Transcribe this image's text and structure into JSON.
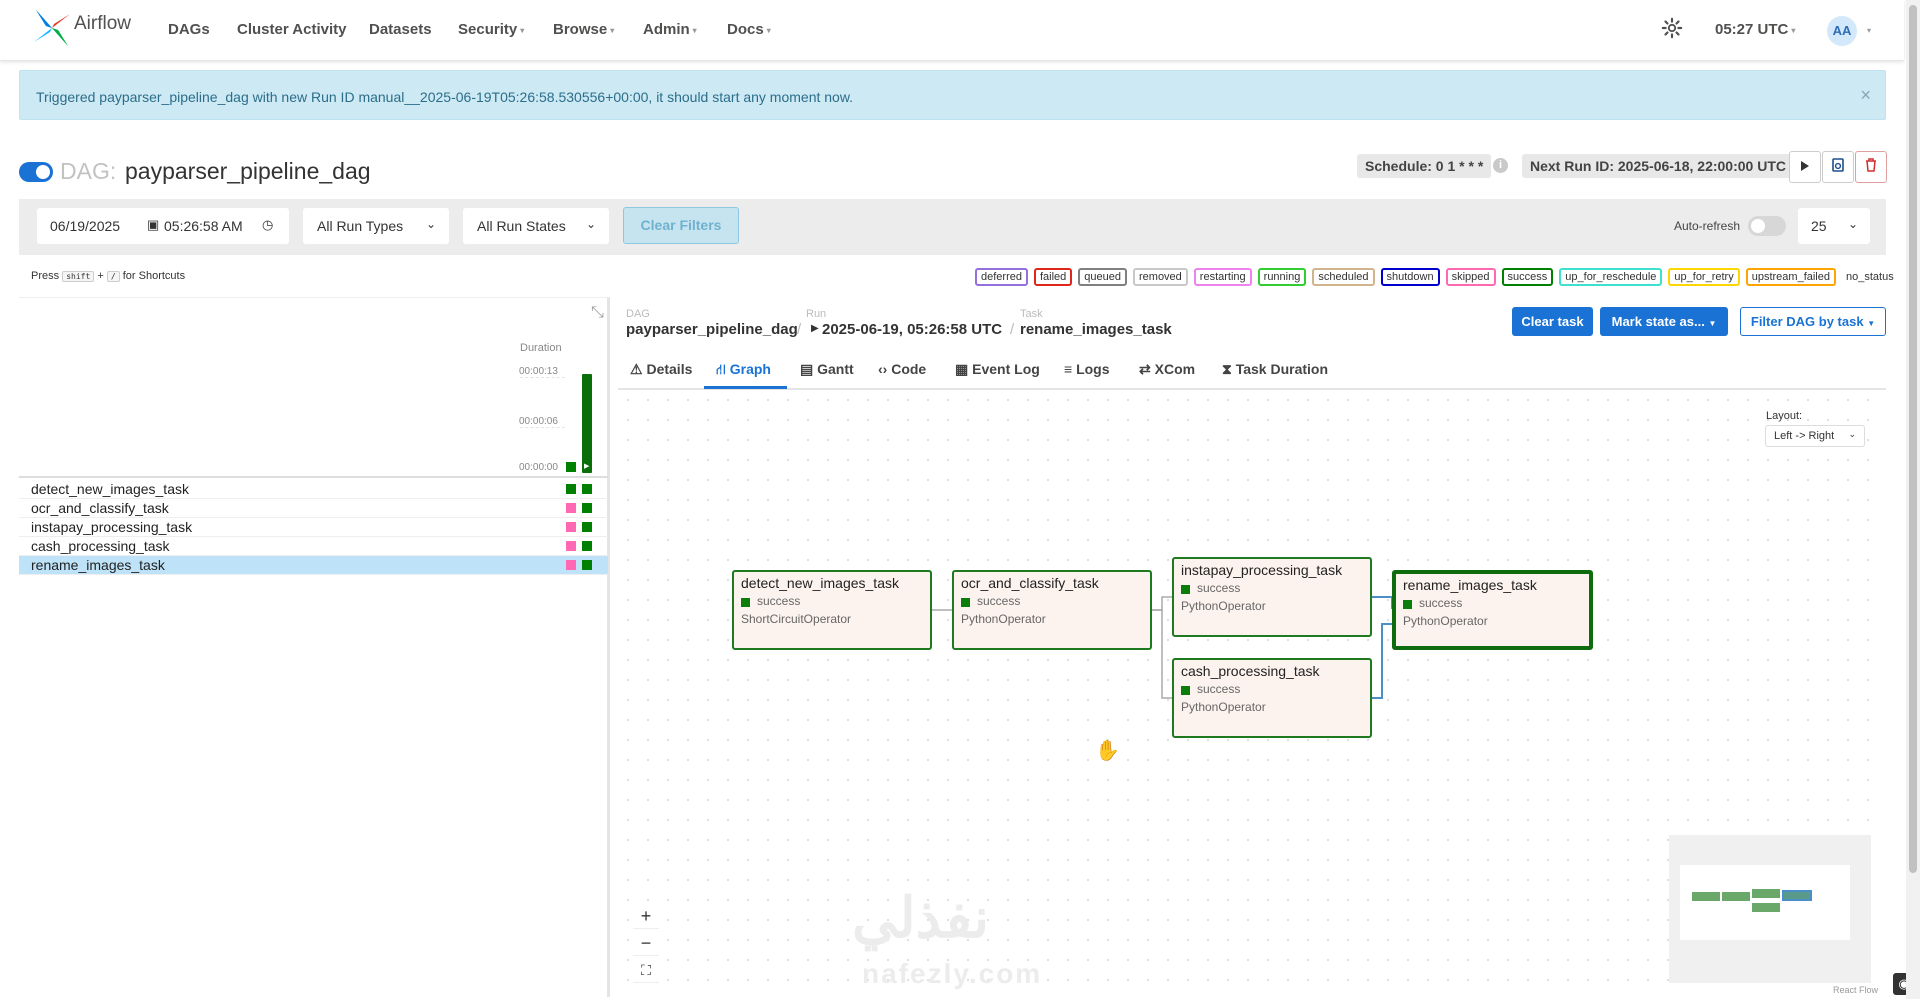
{
  "nav": {
    "brand": "Airflow",
    "items": [
      {
        "label": "DAGs",
        "caret": false
      },
      {
        "label": "Cluster Activity",
        "caret": false
      },
      {
        "label": "Datasets",
        "caret": false
      },
      {
        "label": "Security",
        "caret": true
      },
      {
        "label": "Browse",
        "caret": true
      },
      {
        "label": "Admin",
        "caret": true
      },
      {
        "label": "Docs",
        "caret": true
      }
    ],
    "time": "05:27 UTC",
    "avatar": "AA"
  },
  "alert": {
    "message": "Triggered payparser_pipeline_dag with new Run ID manual__2025-06-19T05:26:58.530556+00:00, it should start any moment now.",
    "close": "×"
  },
  "header": {
    "dag_prefix": "DAG:",
    "dag_name": "payparser_pipeline_dag",
    "schedule": "Schedule: 0 1 * * *",
    "next_run": "Next Run ID: 2025-06-18, 22:00:00 UTC"
  },
  "filters": {
    "date": "06/19/2025",
    "time": "05:26:58  AM",
    "run_types": "All Run Types",
    "run_states": "All Run States",
    "clear": "Clear Filters",
    "auto_refresh": "Auto-refresh",
    "page_size": "25"
  },
  "shortcuts": {
    "press": "Press",
    "key1": "shift",
    "plus": "+",
    "key2": "/",
    "suffix": "for Shortcuts"
  },
  "legend": [
    {
      "label": "deferred",
      "color": "#9370db"
    },
    {
      "label": "failed",
      "color": "#e0251b"
    },
    {
      "label": "queued",
      "color": "#808080"
    },
    {
      "label": "removed",
      "color": "#c9c9c9"
    },
    {
      "label": "restarting",
      "color": "#ee82ee"
    },
    {
      "label": "running",
      "color": "#32cd32"
    },
    {
      "label": "scheduled",
      "color": "#d2b48c"
    },
    {
      "label": "shutdown",
      "color": "#0000cd"
    },
    {
      "label": "skipped",
      "color": "#ff69b4"
    },
    {
      "label": "success",
      "color": "#008000"
    },
    {
      "label": "up_for_reschedule",
      "color": "#40e0d0"
    },
    {
      "label": "up_for_retry",
      "color": "#ffd700"
    },
    {
      "label": "upstream_failed",
      "color": "#ffa500"
    },
    {
      "label": "no_status",
      "color": ""
    }
  ],
  "grid": {
    "duration_label": "Duration",
    "ticks": [
      "00:00:13",
      "00:00:06",
      "00:00:00"
    ],
    "tasks": [
      "detect_new_images_task",
      "ocr_and_classify_task",
      "instapay_processing_task",
      "cash_processing_task",
      "rename_images_task"
    ]
  },
  "breadcrumb": {
    "dag_label": "DAG",
    "dag": "payparser_pipeline_dag",
    "run_label": "Run",
    "run": "2025-06-19, 05:26:58 UTC",
    "task_label": "Task",
    "task": "rename_images_task",
    "sep": "/"
  },
  "actions": {
    "clear_task": "Clear task",
    "mark_state": "Mark state as...",
    "filter_dag": "Filter DAG by task"
  },
  "tabs": [
    {
      "icon": "⚠",
      "label": "Details"
    },
    {
      "icon": "⛙",
      "label": "Graph"
    },
    {
      "icon": "▤",
      "label": "Gantt"
    },
    {
      "icon": "‹›",
      "label": "Code"
    },
    {
      "icon": "▦",
      "label": "Event Log"
    },
    {
      "icon": "≡",
      "label": "Logs"
    },
    {
      "icon": "⇄",
      "label": "XCom"
    },
    {
      "icon": "⧗",
      "label": "Task Duration"
    }
  ],
  "graph": {
    "layout_label": "Layout:",
    "layout_value": "Left -> Right",
    "nodes": [
      {
        "title": "detect_new_images_task",
        "state": "success",
        "operator": "ShortCircuitOperator"
      },
      {
        "title": "ocr_and_classify_task",
        "state": "success",
        "operator": "PythonOperator"
      },
      {
        "title": "instapay_processing_task",
        "state": "success",
        "operator": "PythonOperator"
      },
      {
        "title": "cash_processing_task",
        "state": "success",
        "operator": "PythonOperator"
      },
      {
        "title": "rename_images_task",
        "state": "success",
        "operator": "PythonOperator"
      }
    ],
    "zoom_in": "+",
    "zoom_out": "−",
    "fit": "⛶",
    "attribution": "React Flow"
  },
  "watermark": {
    "arabic": "نفذلي",
    "latin": "nafezly.com"
  }
}
